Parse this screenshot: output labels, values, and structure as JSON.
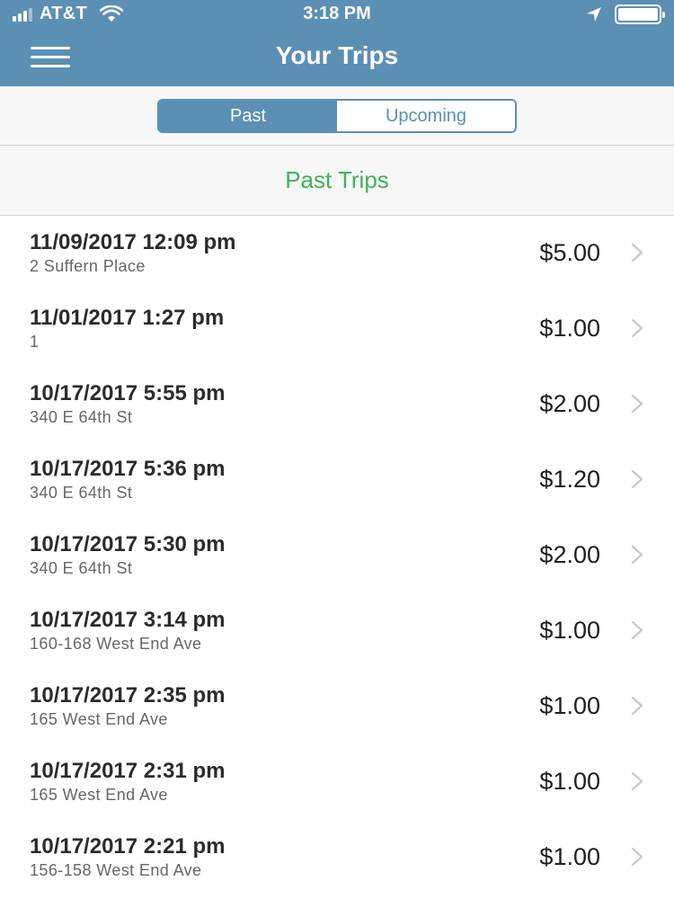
{
  "status_bar": {
    "carrier": "AT&T",
    "time": "3:18 PM"
  },
  "header": {
    "title": "Your Trips"
  },
  "segments": {
    "past": "Past",
    "upcoming": "Upcoming",
    "selected": "Past"
  },
  "section": {
    "title": "Past Trips"
  },
  "colors": {
    "header_bg": "#5b8fb4",
    "section_title": "#3fb25b"
  },
  "trips": [
    {
      "datetime": "11/09/2017 12:09 pm",
      "address": "2 Suffern Place",
      "amount": "$5.00"
    },
    {
      "datetime": "11/01/2017 1:27 pm",
      "address": "1",
      "amount": "$1.00"
    },
    {
      "datetime": "10/17/2017 5:55 pm",
      "address": "340 E 64th St",
      "amount": "$2.00"
    },
    {
      "datetime": "10/17/2017 5:36 pm",
      "address": "340 E 64th St",
      "amount": "$1.20"
    },
    {
      "datetime": "10/17/2017 5:30 pm",
      "address": "340 E 64th St",
      "amount": "$2.00"
    },
    {
      "datetime": "10/17/2017 3:14 pm",
      "address": "160-168 West End Ave",
      "amount": "$1.00"
    },
    {
      "datetime": "10/17/2017 2:35 pm",
      "address": "165 West End Ave",
      "amount": "$1.00"
    },
    {
      "datetime": "10/17/2017 2:31 pm",
      "address": "165 West End Ave",
      "amount": "$1.00"
    },
    {
      "datetime": "10/17/2017 2:21 pm",
      "address": "156-158 West End Ave",
      "amount": "$1.00"
    }
  ]
}
